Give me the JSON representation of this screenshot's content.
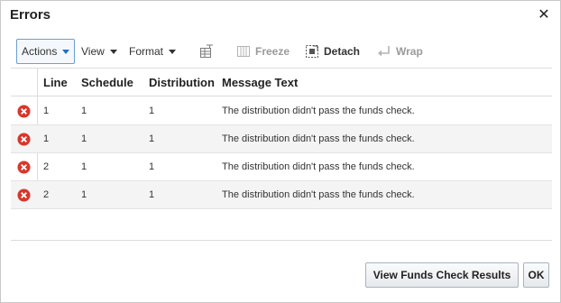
{
  "dialog": {
    "title": "Errors",
    "close_glyph": "✕"
  },
  "toolbar": {
    "actions_label": "Actions",
    "view_label": "View",
    "format_label": "Format",
    "freeze_label": "Freeze",
    "detach_label": "Detach",
    "wrap_label": "Wrap"
  },
  "table": {
    "columns": [
      "Line",
      "Schedule",
      "Distribution",
      "Message Text"
    ],
    "rows": [
      {
        "line": "1",
        "schedule": "1",
        "distribution": "1",
        "message": "The distribution didn't pass the funds check."
      },
      {
        "line": "1",
        "schedule": "1",
        "distribution": "1",
        "message": "The distribution didn't pass the funds check."
      },
      {
        "line": "2",
        "schedule": "1",
        "distribution": "1",
        "message": "The distribution didn't pass the funds check."
      },
      {
        "line": "2",
        "schedule": "1",
        "distribution": "1",
        "message": "The distribution didn't pass the funds check."
      }
    ]
  },
  "footer": {
    "results_label": "View Funds Check Results",
    "ok_label": "OK"
  },
  "colors": {
    "error_red": "#d9362b",
    "actions_border": "#6a9fd0",
    "caret_blue": "#1f6fc5"
  },
  "icons": {
    "error": "error-circle-icon",
    "close": "close-icon",
    "query_by_example": "query-by-example-icon",
    "freeze": "freeze-icon",
    "detach": "detach-icon",
    "wrap": "wrap-icon"
  }
}
